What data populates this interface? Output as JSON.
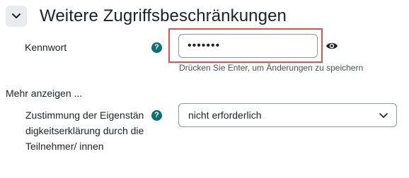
{
  "section": {
    "title": "Weitere Zugriffsbeschränkungen",
    "toggle_icon": "chevron-down-icon"
  },
  "password": {
    "label": "Kennwort",
    "help_icon_text": "?",
    "value_masked": "•••••••",
    "hint": "Drücken Sie Enter, um Änderungen zu speichern",
    "reveal_icon": "eye-icon",
    "highlight_color": "#d9534f"
  },
  "more": {
    "label": "Mehr anzeigen ..."
  },
  "consent": {
    "label": "Zustimmung der Eigenständigkeitserklärung durch die Teilnehmer/ innen",
    "help_icon_text": "?",
    "selected": "nicht erforderlich"
  },
  "colors": {
    "help_icon": "#0f6e72",
    "border": "#8f959e",
    "toggle_bg": "#e9ecef"
  }
}
